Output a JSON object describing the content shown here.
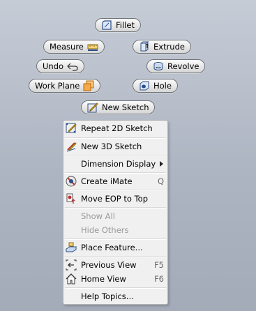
{
  "marking_menu": {
    "fillet": "Fillet",
    "measure": "Measure",
    "extrude": "Extrude",
    "undo": "Undo",
    "revolve": "Revolve",
    "work_plane": "Work Plane",
    "hole": "Hole",
    "new_sketch": "New Sketch"
  },
  "context_menu": {
    "items": [
      {
        "label": "Repeat 2D Sketch",
        "shortcut": ""
      },
      {
        "label": "New 3D Sketch",
        "shortcut": ""
      },
      {
        "label": "Dimension Display",
        "shortcut": ""
      },
      {
        "label": "Create iMate",
        "shortcut": "Q"
      },
      {
        "label": "Move EOP to Top",
        "shortcut": ""
      },
      {
        "label": "Show All",
        "shortcut": ""
      },
      {
        "label": "Hide Others",
        "shortcut": ""
      },
      {
        "label": "Place Feature...",
        "shortcut": ""
      },
      {
        "label": "Previous View",
        "shortcut": "F5"
      },
      {
        "label": "Home View",
        "shortcut": "F6"
      },
      {
        "label": "Help Topics...",
        "shortcut": ""
      }
    ]
  },
  "colors": {
    "background": "#b4bcc8",
    "menu_bg": "#f0f0f0",
    "disabled_text": "#9a9a9a"
  }
}
